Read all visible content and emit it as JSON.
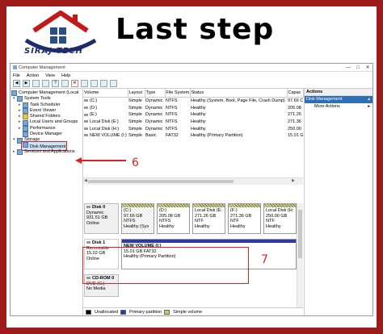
{
  "banner": {
    "logo_text": "SIRAJ TECH",
    "title": "Last step"
  },
  "window": {
    "title": "Computer Management",
    "controls": [
      "—",
      "□",
      "✕"
    ]
  },
  "menu": [
    "File",
    "Action",
    "View",
    "Help"
  ],
  "tree": {
    "items": [
      {
        "label": "Computer Management (Local",
        "level": 0
      },
      {
        "label": "System Tools",
        "level": 1
      },
      {
        "label": "Task Scheduler",
        "level": 2
      },
      {
        "label": "Event Viewer",
        "level": 2
      },
      {
        "label": "Shared Folders",
        "level": 2
      },
      {
        "label": "Local Users and Groups",
        "level": 2
      },
      {
        "label": "Performance",
        "level": 2
      },
      {
        "label": "Device Manager",
        "level": 2
      },
      {
        "label": "Storage",
        "level": 1
      },
      {
        "label": "Disk Management",
        "level": 2
      },
      {
        "label": "Services and Applications",
        "level": 1
      }
    ]
  },
  "volumes": {
    "headers": [
      "Volume",
      "Layout",
      "Type",
      "File System",
      "Status",
      "Capac"
    ],
    "rows": [
      [
        "(C:)",
        "Simple",
        "Dynamic",
        "NTFS",
        "Healthy (System, Boot, Page File, Crash Dump)",
        "97.66 C"
      ],
      [
        "(D:)",
        "Simple",
        "Dynamic",
        "NTFS",
        "Healthy",
        "205.08"
      ],
      [
        "(E:)",
        "Simple",
        "Dynamic",
        "NTFS",
        "Healthy",
        "271.26"
      ],
      [
        "Local Disk (E:)",
        "Simple",
        "Dynamic",
        "NTFS",
        "Healthy",
        "271.36"
      ],
      [
        "Local Disk (H:)",
        "Simple",
        "Dynamic",
        "NTFS",
        "Healthy",
        "250.00"
      ],
      [
        "NEW VOLUME (I:)",
        "Simple",
        "Basic",
        "FAT32",
        "Healthy (Primary Partition)",
        "15.01 G"
      ]
    ]
  },
  "disks": [
    {
      "name": "Disk 0",
      "lines": [
        "Dynamic",
        "931.51 GB",
        "Online"
      ],
      "partitions": [
        {
          "name": "(C:)",
          "lines": [
            "97.66 GB NTFS",
            "Healthy (Sys"
          ]
        },
        {
          "name": "(D:)",
          "lines": [
            "205.08 GB NTFS",
            "Healthy"
          ]
        },
        {
          "name": "Local Disk (E:",
          "lines": [
            "271.26 GB NTF",
            "Healthy"
          ]
        },
        {
          "name": "(F:)",
          "lines": [
            "271.36 GB NTF",
            "Healthy"
          ]
        },
        {
          "name": "Local Disk (H:",
          "lines": [
            "250.00 GB NTF",
            "Healthy"
          ]
        }
      ]
    },
    {
      "name": "Disk 1",
      "lines": [
        "Removable",
        "15.02 GB",
        "Online"
      ],
      "partitions": [
        {
          "name": "NEW VOLUME (I:)",
          "lines": [
            "15.01 GB FAT32",
            "Healthy (Primary Partition)"
          ]
        }
      ]
    },
    {
      "name": "CD-ROM 0",
      "lines": [
        "DVD (G:)",
        "",
        "No Media"
      ],
      "partitions": []
    }
  ],
  "legend": [
    {
      "label": "Unallocated",
      "color": "#000000"
    },
    {
      "label": "Primary partition",
      "color": "#2b3aa6"
    },
    {
      "label": "Simple volume",
      "color": "#c9c96a"
    }
  ],
  "actions": {
    "header": "Actions",
    "selected": "Disk Management",
    "items": [
      "More Actions"
    ]
  },
  "annotations": {
    "step6": "6",
    "step7": "7"
  },
  "colors": {
    "frame": "#9e1b1b",
    "highlight": "#dd2222",
    "selection": "#2e6fb5"
  }
}
